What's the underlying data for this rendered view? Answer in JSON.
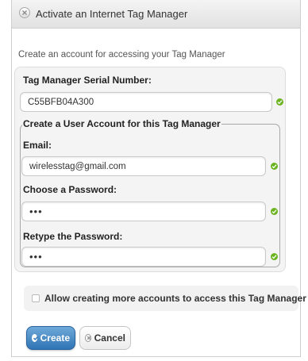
{
  "dialog": {
    "title": "Activate an Internet Tag Manager",
    "intro": "Create an account for accessing your Tag Manager"
  },
  "serial": {
    "label": "Tag Manager Serial Number:",
    "value": "C55BFB04A300"
  },
  "account": {
    "legend": "Create a User Account for this Tag Manager",
    "email_label": "Email:",
    "email_value": "wirelesstag@gmail.com",
    "password_label": "Choose a Password:",
    "password_value": "•••",
    "retype_label": "Retype the Password:",
    "retype_value": "•••"
  },
  "allow": {
    "label": "Allow creating more accounts to access this Tag Manager",
    "checked": false
  },
  "buttons": {
    "create_label": "Create",
    "cancel_label": "Cancel"
  },
  "icons": {
    "close": "close-circle-icon",
    "valid": "check-icon",
    "create": "check-icon",
    "cancel": "close-circle-icon"
  },
  "colors": {
    "primary": "#2f74b5",
    "valid": "#6bb31f"
  }
}
